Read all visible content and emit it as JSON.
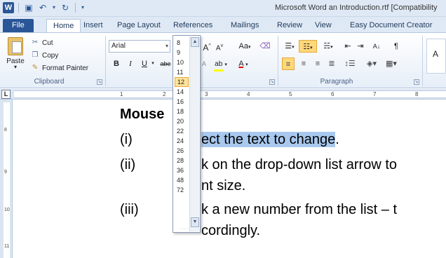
{
  "window": {
    "title": "Microsoft Word an Introduction.rtf [Compatibility",
    "app_icon": "W"
  },
  "tabs": [
    "File",
    "Home",
    "Insert",
    "Page Layout",
    "References",
    "Mailings",
    "Review",
    "View",
    "Easy Document Creator"
  ],
  "active_tab": "Home",
  "clipboard": {
    "paste_label": "Paste",
    "cut_label": "Cut",
    "copy_label": "Copy",
    "format_painter_label": "Format Painter",
    "group_label": "Clipboard"
  },
  "font": {
    "name": "Arial",
    "size": "12",
    "bold": "B",
    "italic": "I",
    "underline": "U",
    "strike": "abe",
    "change_case": "Aa",
    "grow": "A",
    "shrink": "A"
  },
  "paragraph": {
    "group_label": "Paragraph",
    "sort": "A↓",
    "pilcrow": "¶"
  },
  "styles": {
    "preview": "A"
  },
  "size_dropdown": {
    "options": [
      "8",
      "9",
      "10",
      "11",
      "12",
      "14",
      "16",
      "18",
      "20",
      "22",
      "24",
      "26",
      "28",
      "36",
      "48",
      "72"
    ],
    "selected": "12"
  },
  "ruler": {
    "numbers": [
      "1",
      "2",
      "3",
      "4",
      "5",
      "6",
      "7",
      "8"
    ],
    "vertical_numbers": [
      "8",
      "9",
      "10",
      "11"
    ]
  },
  "document": {
    "heading": "Mouse",
    "items": [
      {
        "num": "(i)",
        "visible_text_selected": "ect the text to change",
        "after": "."
      },
      {
        "num": "(ii)",
        "line1": "k on the drop-down list arrow to",
        "line2": "nt size."
      },
      {
        "num": "(iii)",
        "line1": "k a new number from the list – t",
        "line2": "cordingly."
      }
    ]
  },
  "colors": {
    "selection": "#a8c8ee",
    "file_tab": "#2a5597",
    "highlight_yellow": "#ffff00",
    "font_color_red": "#e00000"
  }
}
